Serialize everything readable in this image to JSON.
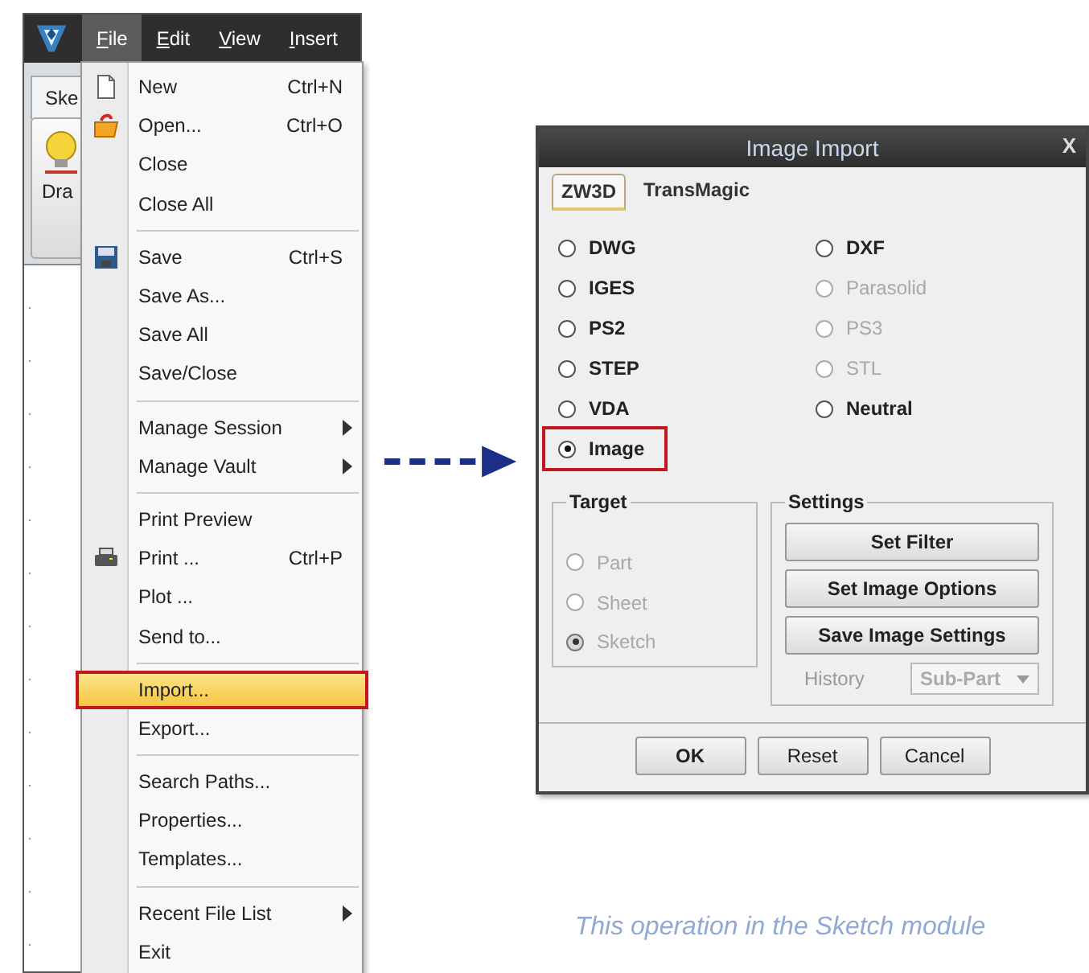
{
  "app": {
    "menubar": [
      {
        "label": "File",
        "selected": true
      },
      {
        "label": "Edit",
        "selected": false
      },
      {
        "label": "View",
        "selected": false
      },
      {
        "label": "Insert",
        "selected": false
      }
    ],
    "ribbon_tab": "Ske",
    "ribbon_button": "Dra"
  },
  "file_menu": [
    {
      "kind": "item",
      "label": "New",
      "shortcut": "Ctrl+N",
      "submenu": false,
      "selected": false
    },
    {
      "kind": "item",
      "label": "Open...",
      "shortcut": "Ctrl+O",
      "submenu": false,
      "selected": false
    },
    {
      "kind": "item",
      "label": "Close",
      "submenu": false,
      "selected": false
    },
    {
      "kind": "item",
      "label": "Close All",
      "submenu": false,
      "selected": false
    },
    {
      "kind": "separator"
    },
    {
      "kind": "item",
      "label": "Save",
      "shortcut": "Ctrl+S",
      "submenu": false,
      "selected": false
    },
    {
      "kind": "item",
      "label": "Save As...",
      "submenu": false,
      "selected": false
    },
    {
      "kind": "item",
      "label": "Save All",
      "submenu": false,
      "selected": false
    },
    {
      "kind": "item",
      "label": "Save/Close",
      "submenu": false,
      "selected": false
    },
    {
      "kind": "separator"
    },
    {
      "kind": "item",
      "label": "Manage Session",
      "submenu": true,
      "selected": false
    },
    {
      "kind": "item",
      "label": "Manage Vault",
      "submenu": true,
      "selected": false
    },
    {
      "kind": "separator"
    },
    {
      "kind": "item",
      "label": "Print Preview",
      "submenu": false,
      "selected": false
    },
    {
      "kind": "item",
      "label": "Print ...",
      "shortcut": "Ctrl+P",
      "submenu": false,
      "selected": false
    },
    {
      "kind": "item",
      "label": "Plot ...",
      "submenu": false,
      "selected": false
    },
    {
      "kind": "item",
      "label": "Send to...",
      "submenu": false,
      "selected": false
    },
    {
      "kind": "separator"
    },
    {
      "kind": "item",
      "label": "Import...",
      "submenu": false,
      "selected": true
    },
    {
      "kind": "item",
      "label": "Export...",
      "submenu": false,
      "selected": false
    },
    {
      "kind": "separator"
    },
    {
      "kind": "item",
      "label": "Search Paths...",
      "submenu": false,
      "selected": false
    },
    {
      "kind": "item",
      "label": "Properties...",
      "submenu": false,
      "selected": false
    },
    {
      "kind": "item",
      "label": "Templates...",
      "submenu": false,
      "selected": false
    },
    {
      "kind": "separator"
    },
    {
      "kind": "item",
      "label": "Recent File List",
      "submenu": true,
      "selected": false
    },
    {
      "kind": "item",
      "label": "Exit",
      "submenu": false,
      "selected": false
    }
  ],
  "dialog": {
    "title": "Image Import",
    "close": "X",
    "tabs": [
      {
        "label": "ZW3D",
        "selected": true
      },
      {
        "label": "TransMagic",
        "selected": false
      }
    ],
    "formats_left": [
      {
        "label": "DWG",
        "selected": false,
        "disabled": false,
        "callout": false
      },
      {
        "label": "IGES",
        "selected": false,
        "disabled": false,
        "callout": false
      },
      {
        "label": "PS2",
        "selected": false,
        "disabled": false,
        "callout": false
      },
      {
        "label": "STEP",
        "selected": false,
        "disabled": false,
        "callout": false
      },
      {
        "label": "VDA",
        "selected": false,
        "disabled": false,
        "callout": false
      },
      {
        "label": "Image",
        "selected": true,
        "disabled": false,
        "callout": true
      }
    ],
    "formats_right": [
      {
        "label": "DXF",
        "selected": false,
        "disabled": false,
        "callout": false
      },
      {
        "label": "Parasolid",
        "selected": false,
        "disabled": true,
        "callout": false
      },
      {
        "label": "PS3",
        "selected": false,
        "disabled": true,
        "callout": false
      },
      {
        "label": "STL",
        "selected": false,
        "disabled": true,
        "callout": false
      },
      {
        "label": "Neutral",
        "selected": false,
        "disabled": false,
        "callout": false
      }
    ],
    "target": {
      "title": "Target",
      "options": [
        {
          "label": "Part",
          "selected": false,
          "disabled": true
        },
        {
          "label": "Sheet",
          "selected": false,
          "disabled": true
        },
        {
          "label": "Sketch",
          "selected": true,
          "disabled": true
        }
      ]
    },
    "settings": {
      "title": "Settings",
      "buttons": [
        "Set Filter",
        "Set Image Options",
        "Save Image Settings"
      ],
      "history": {
        "label": "History",
        "value": "Sub-Part",
        "disabled": true
      }
    },
    "buttons": [
      "OK",
      "Reset",
      "Cancel"
    ]
  },
  "caption": "This operation in the Sketch module"
}
